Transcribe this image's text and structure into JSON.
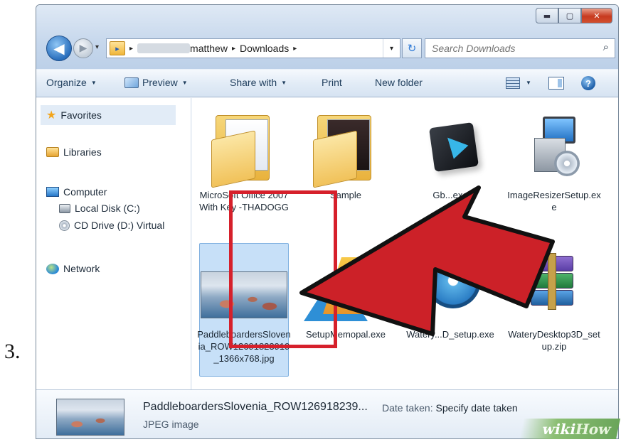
{
  "step": "3.",
  "window": {
    "nav": {
      "back": "◀",
      "forward": "▶",
      "dropdown": "▾"
    },
    "address": {
      "path": [
        "matthew",
        "Downloads"
      ],
      "separator": "▸",
      "dropdown": "▾"
    },
    "refresh": "↻",
    "search": {
      "placeholder": "Search Downloads",
      "icon": "search-icon"
    },
    "caption_buttons": {
      "minimize": "▬",
      "maximize": "▢",
      "close": "✕"
    }
  },
  "toolbar": {
    "organize": "Organize",
    "preview": "Preview",
    "share_with": "Share with",
    "print": "Print",
    "new_folder": "New folder",
    "caret": "▼",
    "help": "?"
  },
  "navpane": {
    "favorites": "Favorites",
    "libraries": "Libraries",
    "computer": "Computer",
    "local_disk": "Local Disk (C:)",
    "cd_drive": "CD Drive (D:) Virtual",
    "network": "Network"
  },
  "files": [
    {
      "name": "MicroSoft Office 2007 With Key -THADOGG",
      "type": "folder",
      "icon": "folder-icon"
    },
    {
      "name": "Sample",
      "type": "folder",
      "icon": "folder-icon"
    },
    {
      "name": "Gb...exe",
      "type": "application",
      "icon": "app-icon"
    },
    {
      "name": "ImageResizerSetup.exe",
      "type": "application",
      "icon": "setup-icon"
    },
    {
      "name": "PaddleboardersSlovenia_ROW12691823919_1366x768.jpg",
      "type": "image",
      "icon": "photo-thumbnail",
      "selected": true
    },
    {
      "name": "SetupMemopal.exe",
      "type": "application",
      "icon": "memopal-icon"
    },
    {
      "name": "Watery...D_setup.exe",
      "type": "application",
      "icon": "disc-icon"
    },
    {
      "name": "WateryDesktop3D_setup.zip",
      "type": "archive",
      "icon": "zip-icon"
    }
  ],
  "details": {
    "name": "PaddleboardersSlovenia_ROW126918239...",
    "date_label": "Date taken:",
    "date_value": "Specify date taken",
    "type": "JPEG image"
  },
  "watermark": {
    "wiki": "wiki",
    "how": "How"
  },
  "colors": {
    "annotation_red": "#d6202b",
    "selection": "#c7e0f8",
    "toolbar_text": "#1e3d5c"
  }
}
